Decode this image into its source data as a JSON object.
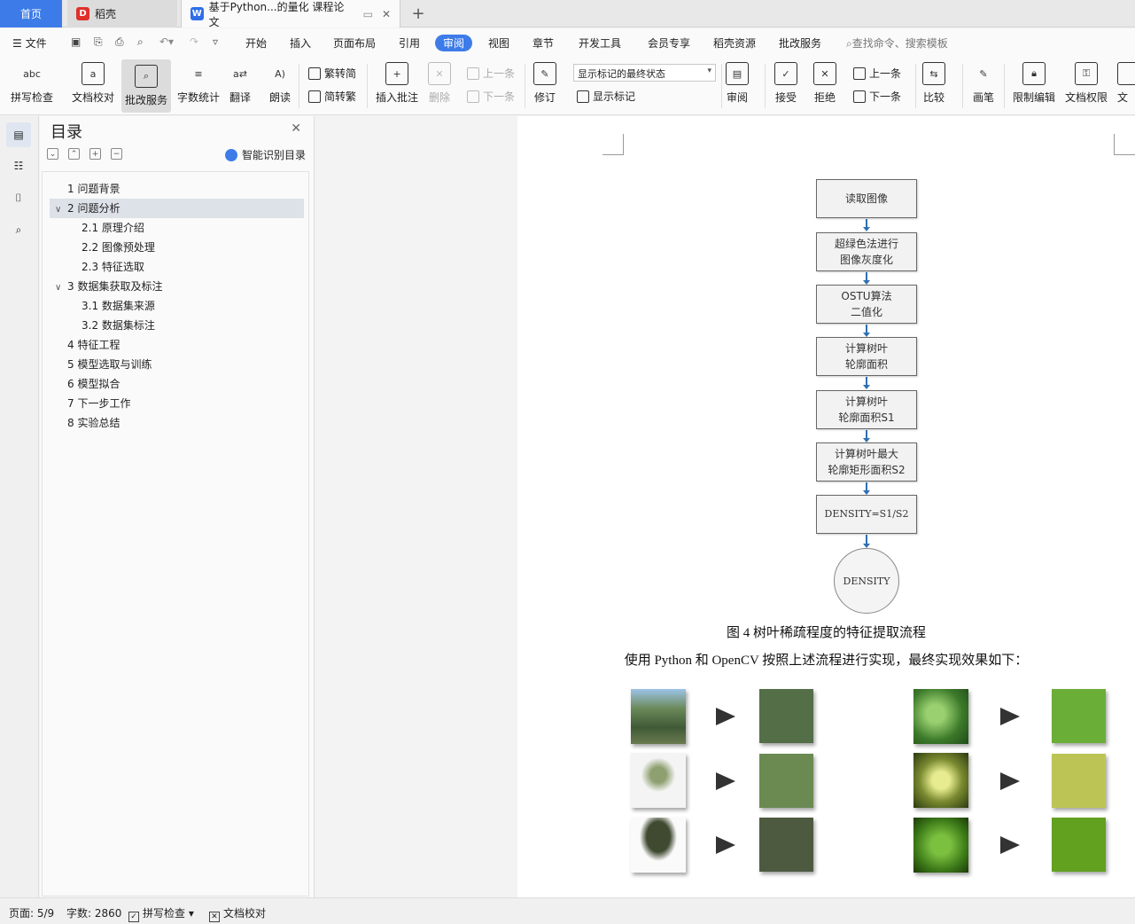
{
  "tabs": {
    "home": "首页",
    "daoke": "稻壳",
    "doc": "基于Python...的量化 课程论文"
  },
  "menu": {
    "file": "文件",
    "items": [
      "开始",
      "插入",
      "页面布局",
      "引用",
      "审阅",
      "视图",
      "章节",
      "开发工具",
      "会员专享",
      "稻壳资源",
      "批改服务"
    ],
    "active_index": 4,
    "search": "查找命令、搜索模板"
  },
  "ribbon": {
    "spell": "拼写检查",
    "proof": "文档校对",
    "pishi": "批改服务",
    "wordcount": "字数统计",
    "translate": "翻译",
    "read": "朗读",
    "fan2jian": "繁转简",
    "jian2fan": "简转繁",
    "insert_comment": "插入批注",
    "delete": "删除",
    "prev_comment": "上一条",
    "next_comment": "下一条",
    "revise": "修订",
    "dropdown": "显示标记的最终状态",
    "show_marks": "显示标记",
    "review": "审阅",
    "accept": "接受",
    "reject": "拒绝",
    "prev": "上一条",
    "next": "下一条",
    "compare": "比较",
    "pen": "画笔",
    "restrict": "限制编辑",
    "perm": "文档权限",
    "more": "文"
  },
  "toc": {
    "title": "目录",
    "smart": "智能识别目录",
    "items": [
      {
        "label": "1  问题背景",
        "level": 1,
        "arrow": ""
      },
      {
        "label": "2  问题分析",
        "level": 1,
        "arrow": "v",
        "selected": true
      },
      {
        "label": "2.1  原理介绍",
        "level": 2,
        "arrow": ""
      },
      {
        "label": "2.2  图像预处理",
        "level": 2,
        "arrow": ""
      },
      {
        "label": "2.3  特征选取",
        "level": 2,
        "arrow": ""
      },
      {
        "label": "3  数据集获取及标注",
        "level": 1,
        "arrow": "v"
      },
      {
        "label": "3.1  数据集来源",
        "level": 2,
        "arrow": ""
      },
      {
        "label": "3.2  数据集标注",
        "level": 2,
        "arrow": ""
      },
      {
        "label": "4  特征工程",
        "level": 1,
        "arrow": ""
      },
      {
        "label": "5  模型选取与训练",
        "level": 1,
        "arrow": ""
      },
      {
        "label": "6  模型拟合",
        "level": 1,
        "arrow": ""
      },
      {
        "label": "7  下一步工作",
        "level": 1,
        "arrow": ""
      },
      {
        "label": "8  实验总结",
        "level": 1,
        "arrow": ""
      }
    ]
  },
  "flow": {
    "b1": "读取图像",
    "b2a": "超绿色法进行",
    "b2b": "图像灰度化",
    "b3a": "OSTU算法",
    "b3b": "二值化",
    "b4a": "计算树叶",
    "b4b": "轮廓面积",
    "b5a": "计算树叶",
    "b5b": "轮廓面积S1",
    "b6a": "计算树叶最大",
    "b6b": "轮廓矩形面积S2",
    "b7": "DENSITY=S1/S2",
    "end": "DENSITY"
  },
  "caption": "图 4  树叶稀疏程度的特征提取流程",
  "para": "使用 Python 和 OpenCV 按照上述流程进行实现，最终实现效果如下：",
  "swatches": {
    "left": [
      "#546e48",
      "#6a8a52",
      "#4d5a40"
    ],
    "right": [
      "#6aae38",
      "#bcc455",
      "#62a020"
    ]
  },
  "status": {
    "page": "页面: 5/9",
    "words": "字数: 2860",
    "spell": "拼写检查",
    "proof": "文档校对"
  }
}
